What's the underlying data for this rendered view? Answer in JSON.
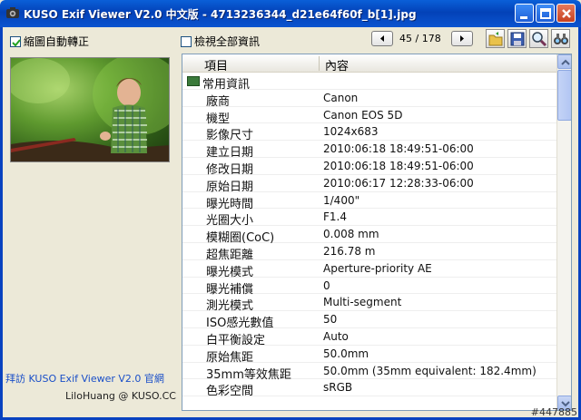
{
  "window": {
    "title": "KUSO Exif Viewer V2.0 中文版 - 4713236344_d21e64f60f_b[1].jpg"
  },
  "toolbar": {
    "auto_rotate_label": "縮圖自動轉正",
    "auto_rotate_checked": true,
    "show_all_label": "檢視全部資訊",
    "show_all_checked": false,
    "counter": "45 / 178"
  },
  "sidebar": {
    "link_text": "拜訪 KUSO Exif Viewer V2.0 官網",
    "credit": "LiloHuang @ KUSO.CC"
  },
  "table": {
    "columns": [
      "項目",
      "內容"
    ],
    "group_label": "常用資訊",
    "rows": [
      {
        "key": "廠商",
        "value": "Canon"
      },
      {
        "key": "機型",
        "value": "Canon EOS 5D"
      },
      {
        "key": "影像尺寸",
        "value": "1024x683"
      },
      {
        "key": "建立日期",
        "value": "2010:06:18 18:49:51-06:00"
      },
      {
        "key": "修改日期",
        "value": "2010:06:18 18:49:51-06:00"
      },
      {
        "key": "原始日期",
        "value": "2010:06:17 12:28:33-06:00"
      },
      {
        "key": "曝光時間",
        "value": "1/400\""
      },
      {
        "key": "光圈大小",
        "value": "F1.4"
      },
      {
        "key": "模糊圈(CoC)",
        "value": "0.008 mm"
      },
      {
        "key": "超焦距離",
        "value": "216.78 m"
      },
      {
        "key": "曝光模式",
        "value": "Aperture-priority AE"
      },
      {
        "key": "曝光補償",
        "value": "0"
      },
      {
        "key": "測光模式",
        "value": "Multi-segment"
      },
      {
        "key": "ISO感光數值",
        "value": "50"
      },
      {
        "key": "白平衡設定",
        "value": "Auto"
      },
      {
        "key": "原始焦距",
        "value": "50.0mm"
      },
      {
        "key": "35mm等效焦距",
        "value": "50.0mm (35mm equivalent: 182.4mm)"
      },
      {
        "key": "色彩空間",
        "value": "sRGB"
      }
    ]
  },
  "watermark": "#447885"
}
